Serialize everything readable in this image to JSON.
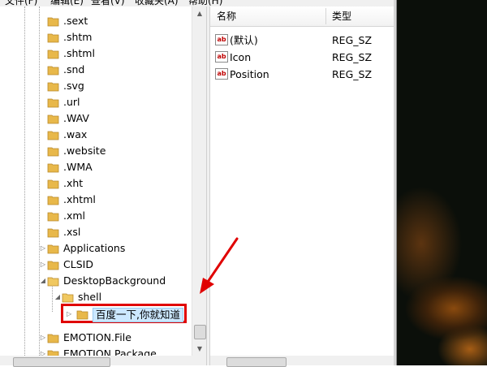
{
  "menu": {
    "items": [
      "文件(F)",
      "编辑(E)",
      "查看(V)",
      "收藏夹(A)",
      "帮助(H)"
    ]
  },
  "tree": {
    "items": [
      {
        "label": ".sext"
      },
      {
        "label": ".shtm"
      },
      {
        "label": ".shtml"
      },
      {
        "label": ".snd"
      },
      {
        "label": ".svg"
      },
      {
        "label": ".url"
      },
      {
        "label": ".WAV"
      },
      {
        "label": ".wax"
      },
      {
        "label": ".website"
      },
      {
        "label": ".WMA"
      },
      {
        "label": ".xht"
      },
      {
        "label": ".xhtml"
      },
      {
        "label": ".xml"
      },
      {
        "label": ".xsl"
      },
      {
        "label": "Applications"
      },
      {
        "label": "CLSID"
      },
      {
        "label": "DesktopBackground"
      },
      {
        "label": "shell"
      },
      {
        "label": "百度一下,你就知道"
      },
      {
        "label": "EMOTION.File"
      },
      {
        "label": "EMOTION.Package"
      }
    ],
    "selected_label": "百度一下,你就知道"
  },
  "values": {
    "columns": {
      "name": "名称",
      "type": "类型"
    },
    "rows": [
      {
        "name": "(默认)",
        "type": "REG_SZ"
      },
      {
        "name": "Icon",
        "type": "REG_SZ"
      },
      {
        "name": "Position",
        "type": "REG_SZ"
      }
    ],
    "icon_text": "ab"
  },
  "colors": {
    "highlight_border": "#e00000",
    "selection_fill": "#cce8ff",
    "arrow": "#e00000",
    "folder": "#e8b84a"
  },
  "icons": {
    "folder": "folder-icon",
    "string_value": "reg-string-value-icon",
    "expander_collapsed": "triangle-right-icon",
    "expander_expanded": "triangle-down-icon"
  }
}
